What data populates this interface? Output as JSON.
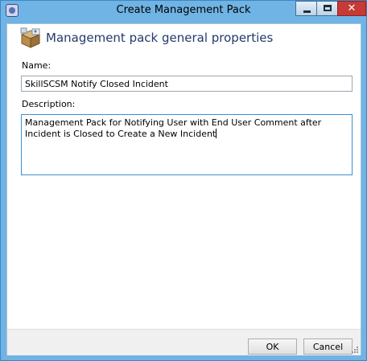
{
  "window": {
    "title": "Create Management Pack",
    "close_glyph": "✕",
    "icons": [
      "app-icon",
      "minimize-icon",
      "maximize-icon",
      "close-icon"
    ]
  },
  "header": {
    "title": "Management pack general properties",
    "icon": "management-pack-icon"
  },
  "form": {
    "name_label": "Name:",
    "name_value": "SkillSCSM Notify Closed Incident",
    "description_label": "Description:",
    "description_value": "Management Pack for Notifying User with End User Comment after Incident is Closed to Create a New Incident"
  },
  "footer": {
    "ok_label": "OK",
    "cancel_label": "Cancel"
  },
  "colors": {
    "window_frame": "#6fb4e4",
    "header_text": "#233a6b",
    "focus_border": "#3a8fd6",
    "close_button": "#c73a35"
  }
}
